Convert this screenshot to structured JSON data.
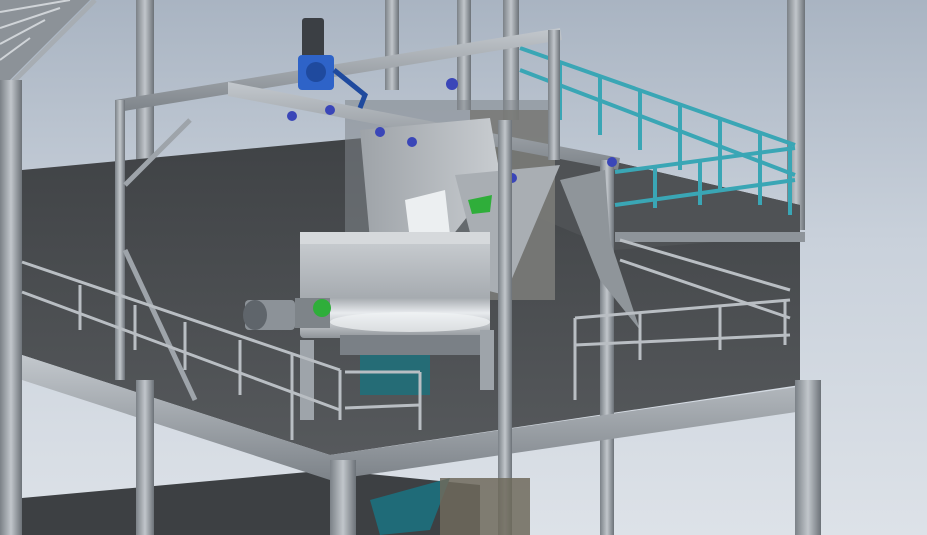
{
  "scene": {
    "kind": "3d-cad-render",
    "subject": "steel-platform-with-mixer",
    "colors": {
      "background_top": "#a9b4c2",
      "background_bottom": "#dde2e8",
      "steel": "#9ea4aa",
      "steel_dark": "#6f757b",
      "floor": "#4a4d50",
      "mixer_body": "#b8bcc0",
      "handrail_teal": "#3aa6b5",
      "motor_blue": "#2e63c8",
      "hopper_teal": "#1f6b78",
      "valve_green": "#2fae3a"
    },
    "icons": [
      "gear-motor-icon",
      "valve-icon",
      "hopper-icon"
    ]
  }
}
